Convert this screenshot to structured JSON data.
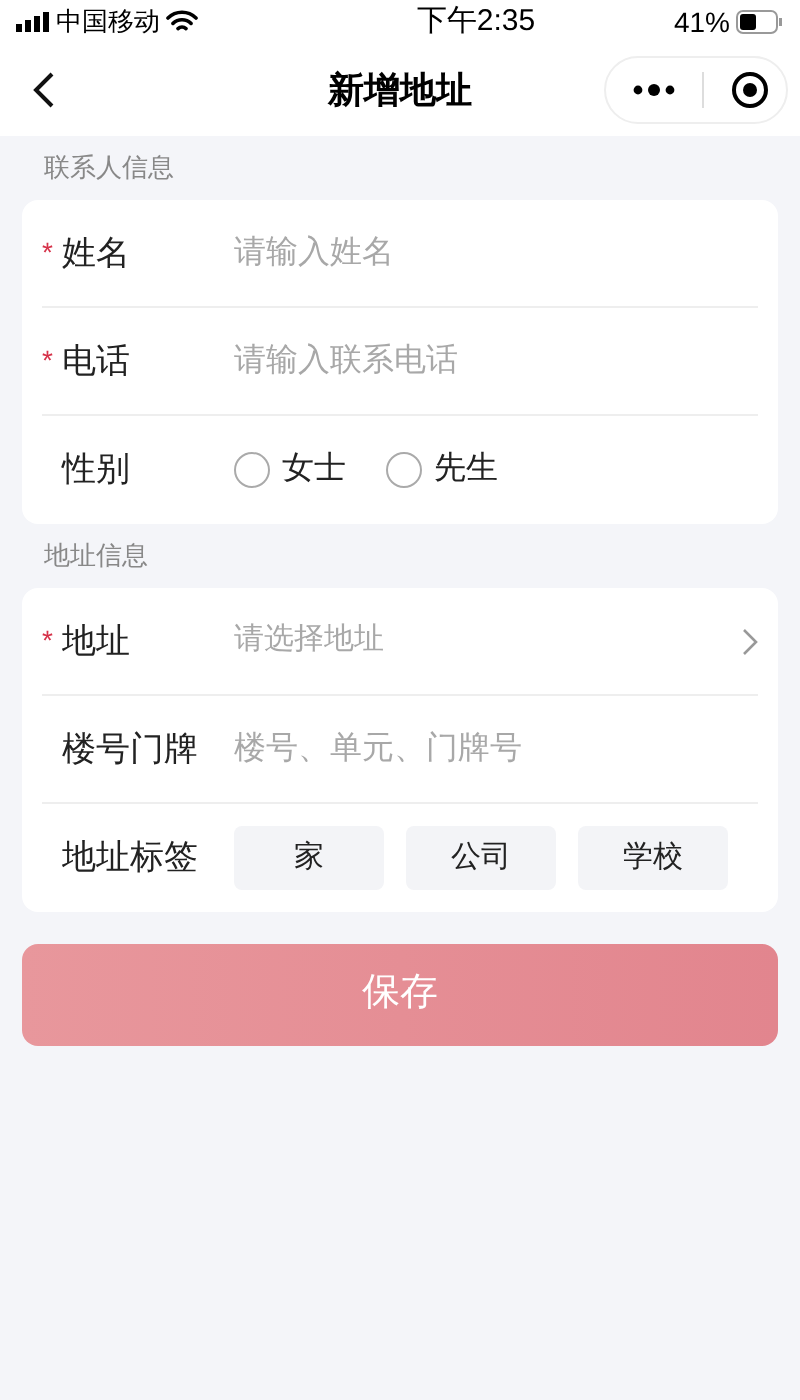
{
  "status_bar": {
    "carrier": "中国移动",
    "time": "下午2:35",
    "battery": "41%"
  },
  "nav_bar": {
    "title": "新增地址"
  },
  "sections": [
    {
      "title": "联系人信息",
      "rows": [
        {
          "kind": "input",
          "required_mark": "*",
          "label": "姓名",
          "placeholder": "请输入姓名"
        },
        {
          "kind": "input",
          "required_mark": "*",
          "label": "电话",
          "placeholder": "请输入联系电话"
        },
        {
          "kind": "radio",
          "label": "性别",
          "options": [
            {
              "label": "女士",
              "selected": false
            },
            {
              "label": "先生",
              "selected": false
            }
          ]
        }
      ]
    },
    {
      "title": "地址信息",
      "rows": [
        {
          "kind": "select",
          "required_mark": "*",
          "label": "地址",
          "placeholder": "请选择地址"
        },
        {
          "kind": "input",
          "label": "楼号门牌",
          "placeholder": "楼号、单元、门牌号"
        },
        {
          "kind": "tags",
          "label": "地址标签",
          "options": [
            {
              "label": "家",
              "selected": false
            },
            {
              "label": "公司",
              "selected": false
            },
            {
              "label": "学校",
              "selected": false
            }
          ]
        }
      ]
    }
  ],
  "save_button": {
    "label": "保存"
  }
}
